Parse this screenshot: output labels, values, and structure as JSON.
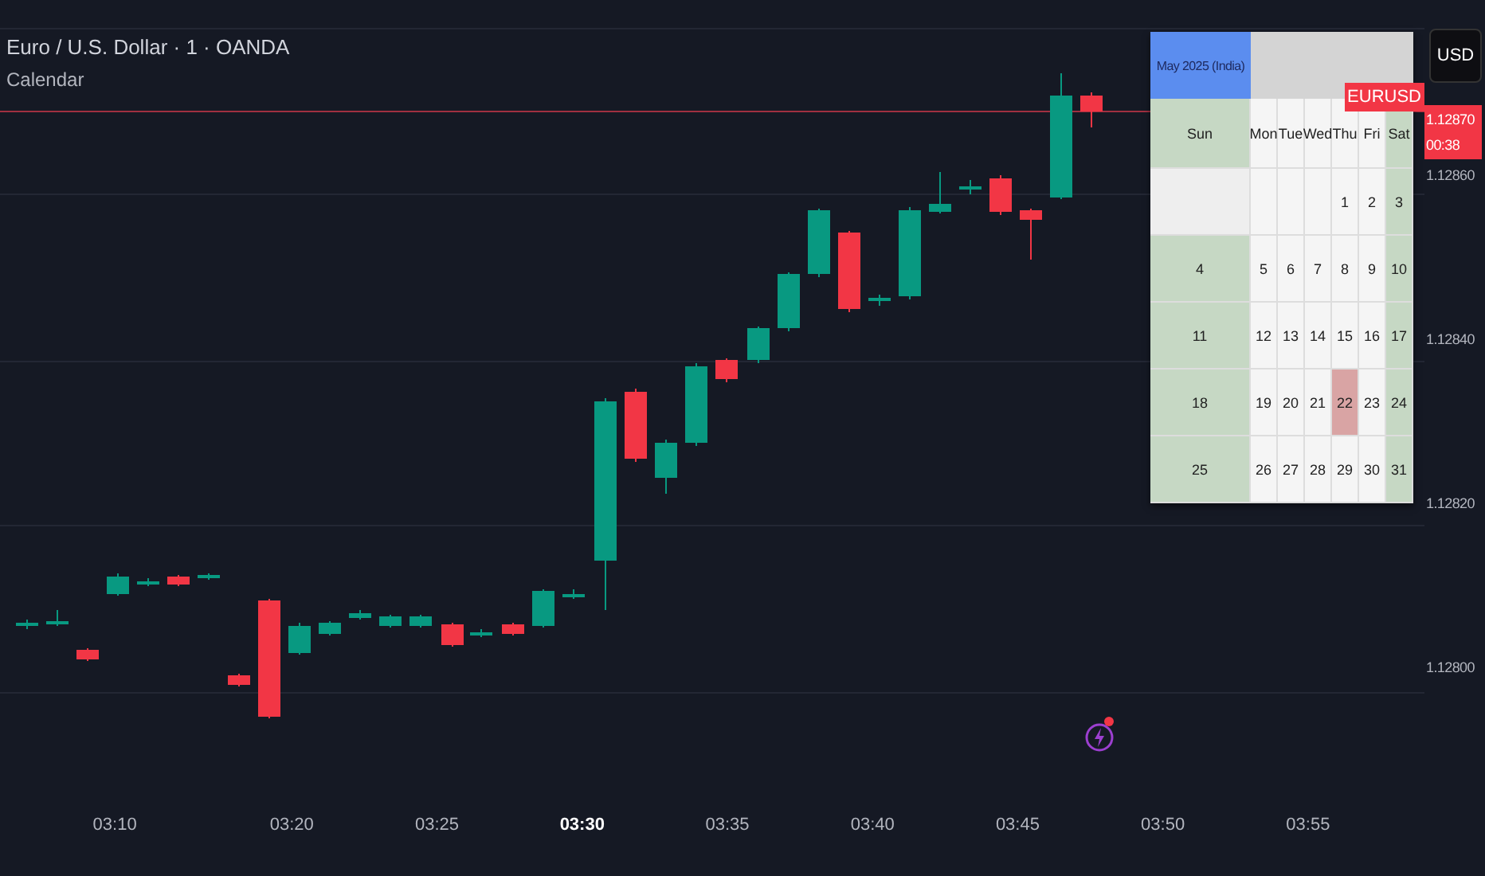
{
  "header": {
    "title": "Euro / U.S. Dollar · 1 · OANDA",
    "indicator": "Calendar"
  },
  "calendar": {
    "title": "May 2025 (India)",
    "weekdays": [
      "Sun",
      "Mon",
      "Tue",
      "Wed",
      "Thu",
      "Fri",
      "Sat"
    ],
    "weeks": [
      [
        {
          "kind": "blank"
        },
        {
          "kind": "blank"
        },
        {
          "kind": "blank"
        },
        {
          "kind": "blank"
        },
        {
          "kind": "day",
          "day": "1",
          "selected": false
        },
        {
          "kind": "day",
          "day": "2",
          "selected": false
        },
        {
          "kind": "day",
          "day": "3",
          "selected": false
        }
      ],
      [
        {
          "kind": "day",
          "day": "4",
          "selected": false
        },
        {
          "kind": "day",
          "day": "5",
          "selected": false
        },
        {
          "kind": "day",
          "day": "6",
          "selected": false
        },
        {
          "kind": "day",
          "day": "7",
          "selected": false
        },
        {
          "kind": "day",
          "day": "8",
          "selected": false
        },
        {
          "kind": "day",
          "day": "9",
          "selected": false
        },
        {
          "kind": "day",
          "day": "10",
          "selected": false
        }
      ],
      [
        {
          "kind": "day",
          "day": "11",
          "selected": false
        },
        {
          "kind": "day",
          "day": "12",
          "selected": false
        },
        {
          "kind": "day",
          "day": "13",
          "selected": false
        },
        {
          "kind": "day",
          "day": "14",
          "selected": false
        },
        {
          "kind": "day",
          "day": "15",
          "selected": false
        },
        {
          "kind": "day",
          "day": "16",
          "selected": false
        },
        {
          "kind": "day",
          "day": "17",
          "selected": false
        }
      ],
      [
        {
          "kind": "day",
          "day": "18",
          "selected": false
        },
        {
          "kind": "day",
          "day": "19",
          "selected": false
        },
        {
          "kind": "day",
          "day": "20",
          "selected": false
        },
        {
          "kind": "day",
          "day": "21",
          "selected": false
        },
        {
          "kind": "day",
          "day": "22",
          "selected": true
        },
        {
          "kind": "day",
          "day": "23",
          "selected": false
        },
        {
          "kind": "day",
          "day": "24",
          "selected": false
        }
      ],
      [
        {
          "kind": "day",
          "day": "25",
          "selected": false
        },
        {
          "kind": "day",
          "day": "26",
          "selected": false
        },
        {
          "kind": "day",
          "day": "27",
          "selected": false
        },
        {
          "kind": "day",
          "day": "28",
          "selected": false
        },
        {
          "kind": "day",
          "day": "29",
          "selected": false
        },
        {
          "kind": "day",
          "day": "30",
          "selected": false
        },
        {
          "kind": "day",
          "day": "31",
          "selected": false
        }
      ]
    ]
  },
  "symbol_tag": "EURUSD",
  "price_axis": {
    "currency": "USD",
    "last_price": "1.12870",
    "countdown": "00:38",
    "labels": [
      "1.12860",
      "1.12840",
      "1.12820",
      "1.12800"
    ]
  },
  "time_axis": [
    {
      "label": "03:10",
      "emphasis": false
    },
    {
      "label": "03:20",
      "emphasis": false
    },
    {
      "label": "03:25",
      "emphasis": false
    },
    {
      "label": "03:30",
      "emphasis": true
    },
    {
      "label": "03:35",
      "emphasis": false
    },
    {
      "label": "03:40",
      "emphasis": false
    },
    {
      "label": "03:45",
      "emphasis": false
    },
    {
      "label": "03:50",
      "emphasis": false
    },
    {
      "label": "03:55",
      "emphasis": false
    }
  ]
}
